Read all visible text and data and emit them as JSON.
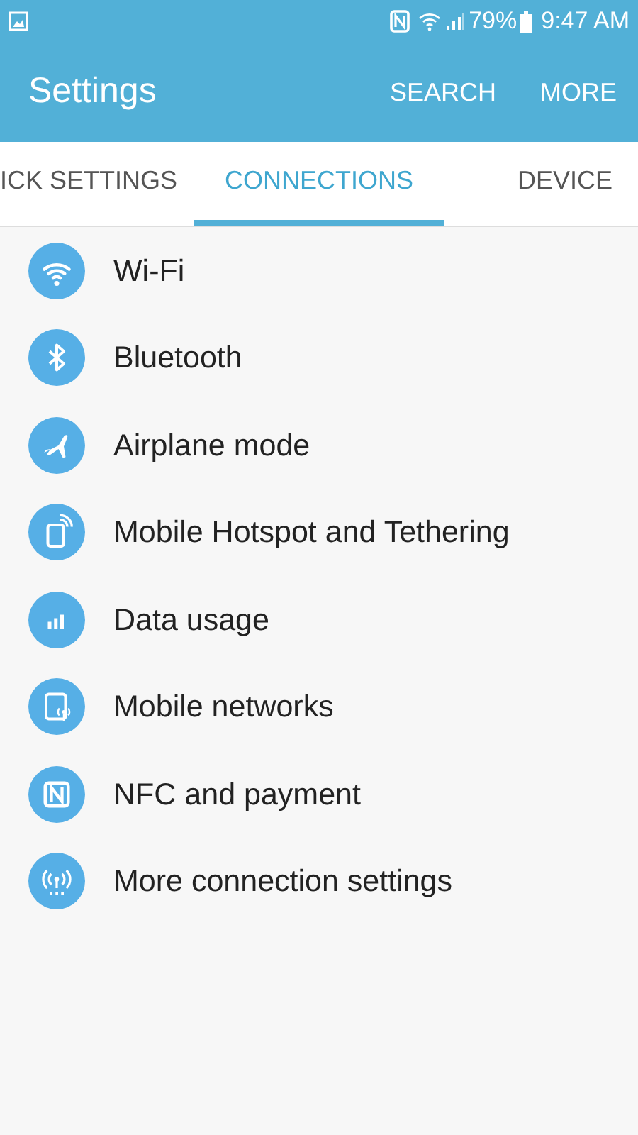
{
  "status_bar": {
    "battery": "79%",
    "time": "9:47 AM"
  },
  "app_bar": {
    "title": "Settings",
    "actions": [
      "SEARCH",
      "MORE"
    ]
  },
  "tabs": [
    {
      "label": "ICK SETTINGS",
      "selected": false
    },
    {
      "label": "CONNECTIONS",
      "selected": true
    },
    {
      "label": "DEVICE",
      "selected": false
    }
  ],
  "items": [
    {
      "label": "Wi-Fi",
      "kind": "wifi"
    },
    {
      "label": "Bluetooth",
      "kind": "bluetooth"
    },
    {
      "label": "Airplane mode",
      "kind": "airplane"
    },
    {
      "label": "Mobile Hotspot and Tethering",
      "kind": "hotspot"
    },
    {
      "label": "Data usage",
      "kind": "data"
    },
    {
      "label": "Mobile networks",
      "kind": "network"
    },
    {
      "label": "NFC and payment",
      "kind": "nfc"
    },
    {
      "label": "More connection settings",
      "kind": "more"
    }
  ]
}
